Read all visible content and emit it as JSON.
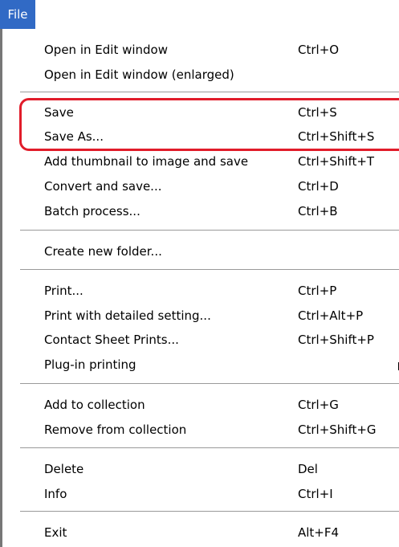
{
  "menubar": {
    "file_label": "File"
  },
  "colors": {
    "menu_highlight": "#316ac5",
    "callout": "#e11c2a"
  },
  "menu": {
    "groups": [
      [
        {
          "label": "Open in Edit window",
          "shortcut": "Ctrl+O"
        },
        {
          "label": "Open in Edit window (enlarged)",
          "shortcut": ""
        }
      ],
      [
        {
          "label": "Save",
          "shortcut": "Ctrl+S"
        },
        {
          "label": "Save As...",
          "shortcut": "Ctrl+Shift+S"
        },
        {
          "label": "Add thumbnail to image and save",
          "shortcut": "Ctrl+Shift+T"
        },
        {
          "label": "Convert and save...",
          "shortcut": "Ctrl+D"
        },
        {
          "label": "Batch process...",
          "shortcut": "Ctrl+B"
        }
      ],
      [
        {
          "label": "Create new folder...",
          "shortcut": ""
        }
      ],
      [
        {
          "label": "Print...",
          "shortcut": "Ctrl+P"
        },
        {
          "label": "Print with detailed setting...",
          "shortcut": "Ctrl+Alt+P"
        },
        {
          "label": "Contact Sheet Prints...",
          "shortcut": "Ctrl+Shift+P"
        },
        {
          "label": "Plug-in printing",
          "shortcut": ""
        }
      ],
      [
        {
          "label": "Add to collection",
          "shortcut": "Ctrl+G"
        },
        {
          "label": "Remove from collection",
          "shortcut": "Ctrl+Shift+G"
        }
      ],
      [
        {
          "label": "Delete",
          "shortcut": "Del"
        },
        {
          "label": "Info",
          "shortcut": "Ctrl+I"
        }
      ],
      [
        {
          "label": "Exit",
          "shortcut": "Alt+F4"
        }
      ]
    ]
  }
}
